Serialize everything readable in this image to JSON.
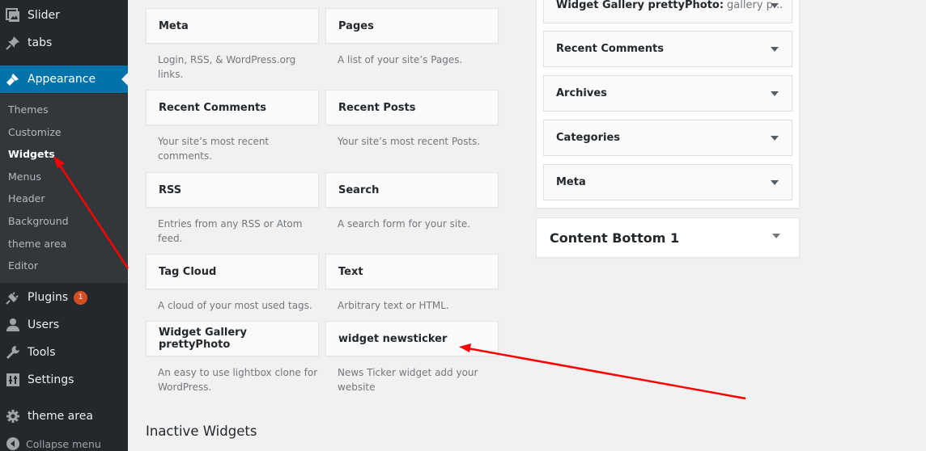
{
  "sidebar": {
    "menu": [
      {
        "label": "Slider",
        "icon": "slider-icon"
      },
      {
        "label": "tabs",
        "icon": "pin-icon"
      },
      {
        "label": "Appearance",
        "icon": "paintbrush-icon"
      },
      {
        "label": "Plugins",
        "icon": "plugin-icon",
        "badge": "1"
      },
      {
        "label": "Users",
        "icon": "users-icon"
      },
      {
        "label": "Tools",
        "icon": "wrench-icon"
      },
      {
        "label": "Settings",
        "icon": "settings-icon"
      },
      {
        "label": "theme area",
        "icon": "gear-icon"
      }
    ],
    "submenu": [
      {
        "label": "Themes"
      },
      {
        "label": "Customize"
      },
      {
        "label": "Widgets",
        "current": true
      },
      {
        "label": "Menus"
      },
      {
        "label": "Header"
      },
      {
        "label": "Background"
      },
      {
        "label": "theme area"
      },
      {
        "label": "Editor"
      }
    ],
    "collapse_label": "Collapse menu"
  },
  "available_widgets": [
    {
      "title": "Meta",
      "desc": "Login, RSS, & WordPress.org links."
    },
    {
      "title": "Pages",
      "desc": "A list of your site’s Pages."
    },
    {
      "title": "Recent Comments",
      "desc": "Your site’s most recent comments."
    },
    {
      "title": "Recent Posts",
      "desc": "Your site’s most recent Posts."
    },
    {
      "title": "RSS",
      "desc": "Entries from any RSS or Atom feed."
    },
    {
      "title": "Search",
      "desc": "A search form for your site."
    },
    {
      "title": "Tag Cloud",
      "desc": "A cloud of your most used tags."
    },
    {
      "title": "Text",
      "desc": "Arbitrary text or HTML."
    },
    {
      "title": "Widget Gallery prettyPhoto",
      "desc": "An easy to use lightbox clone for WordPress."
    },
    {
      "title": "widget newsticker",
      "desc": "News Ticker widget add your website"
    }
  ],
  "inactive_widgets_title": "Inactive Widgets",
  "widget_area": {
    "widgets": [
      {
        "title": "Widget Gallery prettyPhoto:",
        "subtitle": "gallery p..."
      },
      {
        "title": "Recent Comments",
        "subtitle": ""
      },
      {
        "title": "Archives",
        "subtitle": ""
      },
      {
        "title": "Categories",
        "subtitle": ""
      },
      {
        "title": "Meta",
        "subtitle": ""
      }
    ]
  },
  "content_bottom": {
    "title": "Content Bottom 1"
  },
  "annotation_color": "#ff0000"
}
